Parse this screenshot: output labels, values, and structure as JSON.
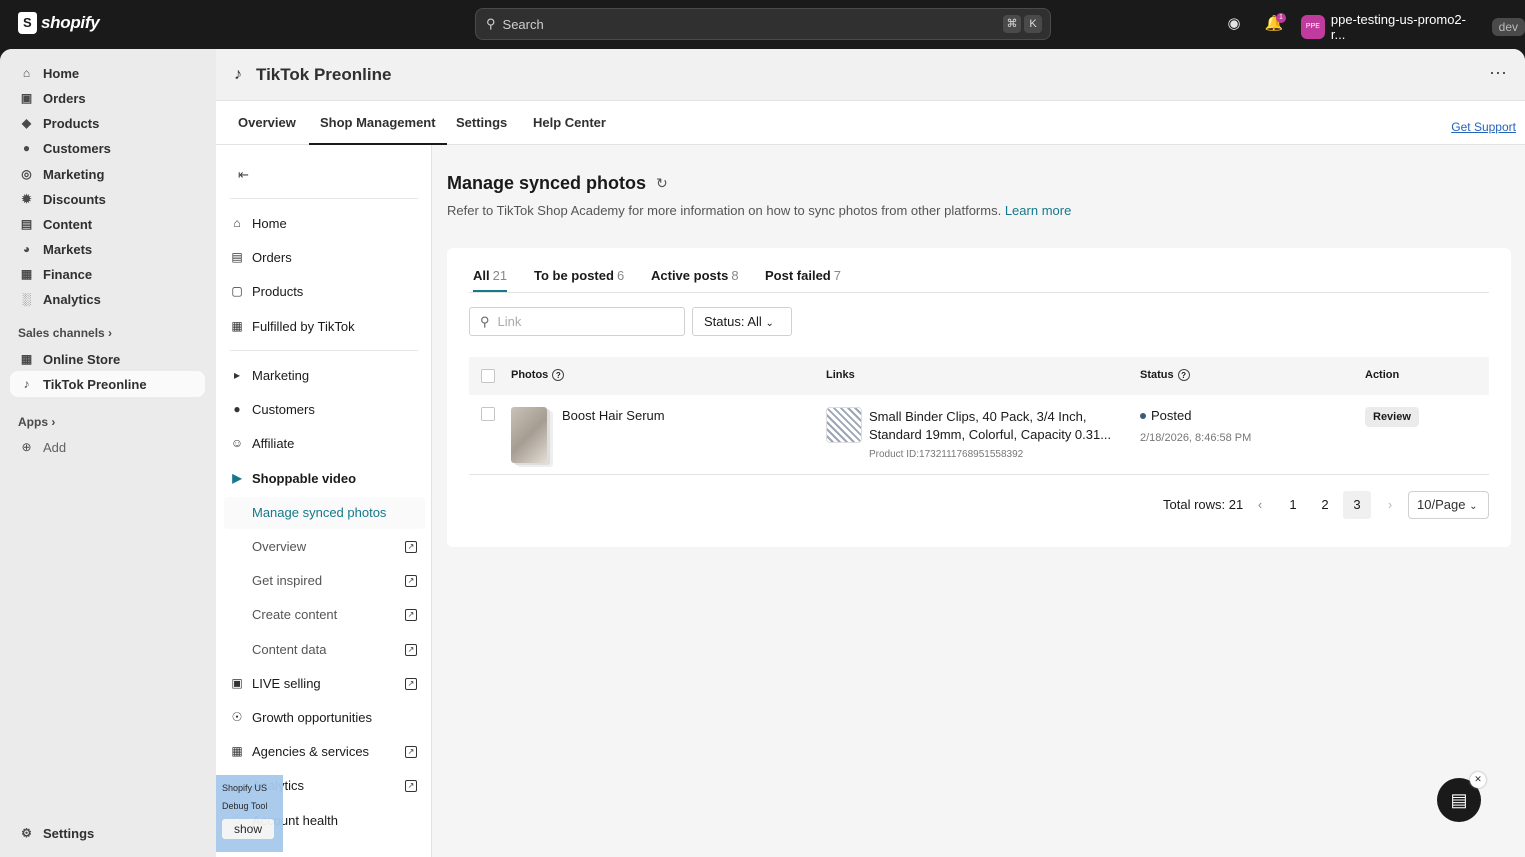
{
  "topbar": {
    "brand": "shopify",
    "search_placeholder": "Search",
    "kbd1": "⌘",
    "kbd2": "K",
    "notif_count": "1",
    "avatar": "PPE",
    "store_name": "ppe-testing-us-promo2-r...",
    "env": "dev"
  },
  "nav": {
    "items": [
      "Home",
      "Orders",
      "Products",
      "Customers",
      "Marketing",
      "Discounts",
      "Content",
      "Markets",
      "Finance",
      "Analytics"
    ],
    "sales_channels": "Sales channels",
    "channels": [
      "Online Store",
      "TikTok Preonline"
    ],
    "apps": "Apps",
    "add": "Add",
    "settings": "Settings"
  },
  "app": {
    "title": "TikTok Preonline",
    "tabs": [
      "Overview",
      "Shop Management",
      "Settings",
      "Help Center"
    ],
    "selected_tab": "Shop Management",
    "support": "Get Support"
  },
  "side": {
    "items": [
      "Home",
      "Orders",
      "Products",
      "Fulfilled by TikTok",
      "Marketing",
      "Customers",
      "Affiliate",
      "Shoppable video"
    ],
    "sub": [
      "Manage synced photos",
      "Overview",
      "Get inspired",
      "Create content",
      "Content data"
    ],
    "more": [
      "LIVE selling",
      "Growth opportunities",
      "Agencies & services",
      "Analytics",
      "Account health"
    ]
  },
  "page": {
    "title": "Manage synced photos",
    "desc": "Refer to TikTok Shop Academy for more information on how to sync photos from other platforms.",
    "learn": "Learn more",
    "tabs": [
      {
        "label": "All",
        "count": "21"
      },
      {
        "label": "To be posted",
        "count": "6"
      },
      {
        "label": "Active posts",
        "count": "8"
      },
      {
        "label": "Post failed",
        "count": "7"
      }
    ],
    "link_placeholder": "Link",
    "status_filter": "Status: All",
    "columns": [
      "Photos",
      "Links",
      "Status",
      "Action"
    ],
    "rows": [
      {
        "photo_name": "Boost Hair Serum",
        "link_line1": "Small Binder Clips, 40 Pack, 3/4 Inch,",
        "link_line2": "Standard 19mm, Colorful, Capacity 0.31...",
        "product_id": "Product ID:1732111768951558392",
        "status": "Posted",
        "date": "2/18/2026, 8:46:58 PM",
        "action": "Review"
      }
    ],
    "total": "Total rows: 21",
    "pages": [
      "1",
      "2",
      "3"
    ],
    "current_page": "3",
    "per_page": "10/Page"
  },
  "debug": {
    "line1": "Shopify US",
    "line2": "Debug Tool",
    "btn": "show"
  }
}
